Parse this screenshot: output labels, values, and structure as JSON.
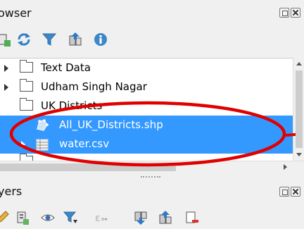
{
  "browser_panel": {
    "title": "owser"
  },
  "browser_toolbar": {
    "icons": [
      "add-layer-icon",
      "refresh-icon",
      "filter-icon",
      "collapse-all-icon",
      "properties-icon"
    ]
  },
  "tree": {
    "items": [
      {
        "label": "Text Data",
        "icon": "folder-icon",
        "expanded": false
      },
      {
        "label": "Udham Singh Nagar",
        "icon": "folder-icon",
        "expanded": false
      },
      {
        "label": "UK Districts",
        "icon": "folder-icon",
        "expanded": true
      },
      {
        "label": "All_UK_Districts.shp",
        "icon": "polygon-layer-icon",
        "selected": true
      },
      {
        "label": "water.csv",
        "icon": "table-icon",
        "selected": true
      }
    ]
  },
  "layers_panel": {
    "title": "yers"
  },
  "layers_toolbar": {
    "icons": [
      "edit-pencil-icon",
      "add-group-icon",
      "visibility-eye-icon",
      "filter-legend-icon",
      "filter-expression-icon",
      "expand-all-icon",
      "collapse-all-icon",
      "remove-layer-icon"
    ]
  },
  "colors": {
    "selection": "#3399ff",
    "annotation": "#e00000"
  }
}
